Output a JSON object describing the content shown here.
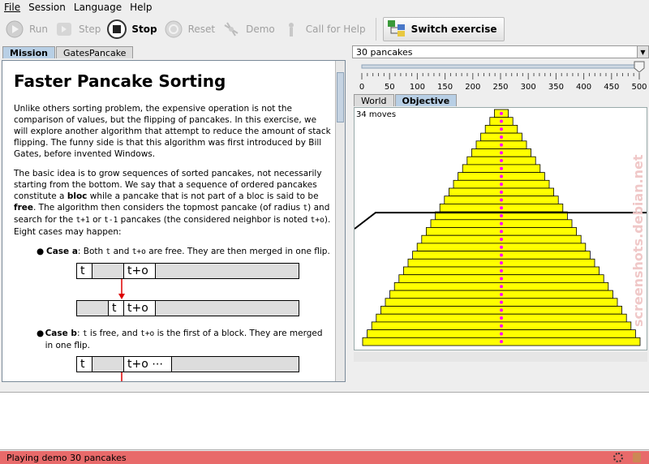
{
  "menu": [
    "File",
    "Session",
    "Language",
    "Help"
  ],
  "toolbar": {
    "run": "Run",
    "step": "Step",
    "stop": "Stop",
    "reset": "Reset",
    "demo": "Demo",
    "call_for_help": "Call for Help",
    "switch_exercise": "Switch exercise"
  },
  "left_tabs": [
    "Mission",
    "GatesPancake"
  ],
  "doc": {
    "title": "Faster Pancake Sorting",
    "p1": "Unlike others sorting problem, the expensive operation is not the comparison of values, but the flipping of pancakes. In this exercise, we will explore another algorithm that attempt to reduce the amount of stack flipping. The funny side is that this algorithm was first introduced by Bill Gates, before invented Windows.",
    "p2_a": "The basic idea is to grow sequences of sorted pancakes, not necessarily starting from the bottom. We say that a sequence of ordered pancakes constitute a ",
    "p2_bloc": "bloc",
    "p2_b": " while a pancake that is not part of a bloc is said to be ",
    "p2_free": "free",
    "p2_c": ". The algorithm then considers the topmost pancake (of radius ",
    "p2_t": "t",
    "p2_d": ") and search for the ",
    "p2_tp1": "t+1",
    "p2_or": " or ",
    "p2_tm1": "t-1",
    "p2_e": " pancakes (the considered neighbor is noted ",
    "p2_to": "t+o",
    "p2_f": "). Eight cases may happen:",
    "case_a_label": "Case a",
    "case_a_1": ": Both ",
    "case_a_t": "t",
    "case_a_2": " and ",
    "case_a_to": "t+o",
    "case_a_3": " are free. They are then merged in one flip.",
    "case_b_label": "Case b",
    "case_b_1": ": ",
    "case_b_t": "t",
    "case_b_2": " is free, and ",
    "case_b_to": "t+o",
    "case_b_3": " is the first of a block. They are merged in one flip.",
    "cell_t": "t",
    "cell_to": "t+o",
    "cell_to_dots": "t+o ⋯"
  },
  "right": {
    "combo": "30 pancakes",
    "slider_ticks": [
      "0",
      "50",
      "100",
      "150",
      "200",
      "250",
      "300",
      "350",
      "400",
      "450",
      "500"
    ],
    "slider_value": 500,
    "tabs": [
      "World",
      "Objective"
    ],
    "moves": "34 moves"
  },
  "pancakes_order": [
    1,
    2,
    3,
    4,
    5,
    6,
    7,
    8,
    9,
    10,
    11,
    12,
    13,
    14,
    15,
    16,
    17,
    18,
    19,
    20,
    21,
    22,
    23,
    24,
    25,
    26,
    27,
    28,
    29,
    30
  ],
  "status": "Playing demo 30 pancakes",
  "colors": {
    "pancake": "#ffff00",
    "center_dot": "#ff00ff",
    "status_bar": "#e86a6a"
  }
}
